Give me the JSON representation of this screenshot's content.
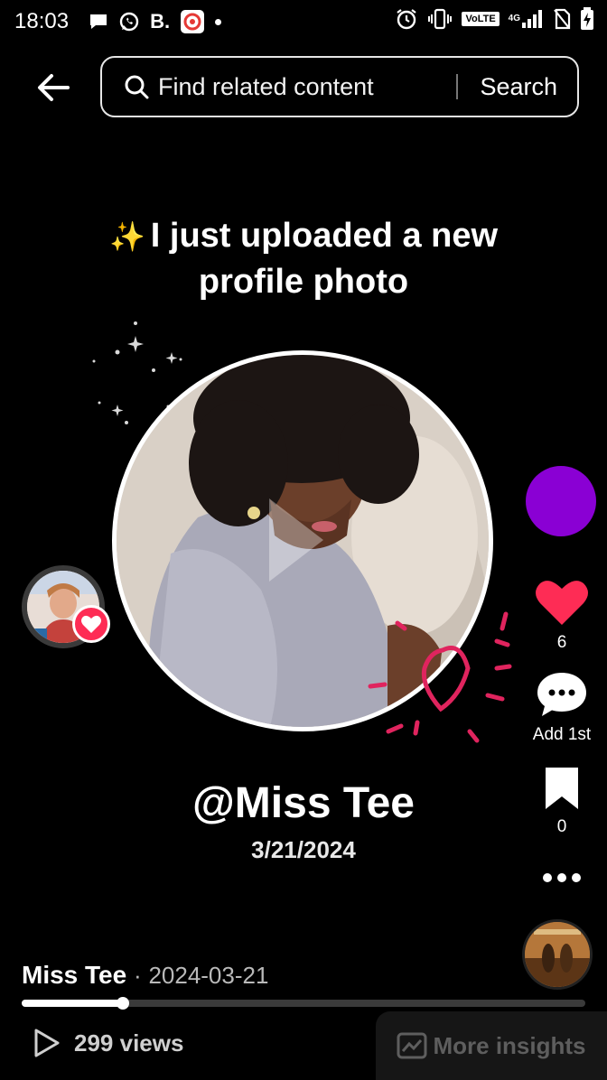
{
  "status_bar": {
    "time": "18:03",
    "carrier_letter": "B.",
    "volte": "VoLTE",
    "network": "4G",
    "icons": [
      "message-icon",
      "whatsapp-icon",
      "app-icon",
      "dot-icon",
      "alarm-icon",
      "vibrate-icon",
      "signal-icon",
      "no-sim-icon",
      "battery-charging-icon"
    ]
  },
  "header": {
    "search_placeholder": "Find related content",
    "search_button": "Search"
  },
  "video": {
    "headline_emoji": "✨",
    "headline": "I just uploaded a new profile photo",
    "handle": "@Miss Tee",
    "date": "3/21/2024"
  },
  "rail": {
    "likes": "6",
    "comments": "Add 1st",
    "saves": "0"
  },
  "footer": {
    "author": "Miss Tee",
    "separator": "·",
    "post_date": "2024-03-21",
    "progress_fraction": 0.18,
    "views": "299 views",
    "insights": "More insights"
  },
  "colors": {
    "accent_red": "#fe2c55",
    "avatar_purple": "#8a00d4",
    "background": "#000000"
  }
}
